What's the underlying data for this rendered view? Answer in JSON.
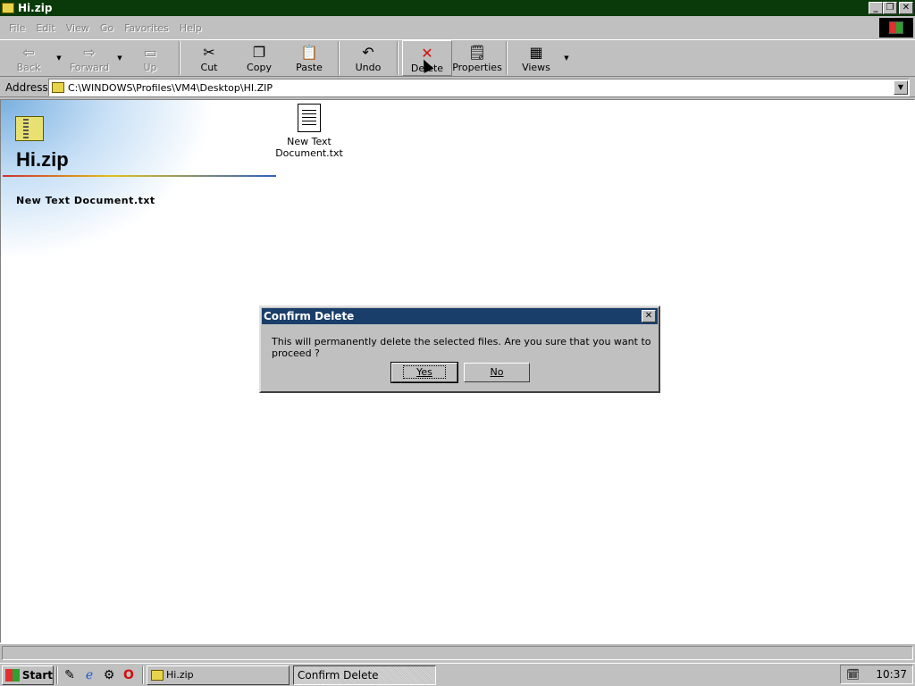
{
  "window": {
    "title": "Hi.zip"
  },
  "menu": [
    "File",
    "Edit",
    "View",
    "Go",
    "Favorites",
    "Help"
  ],
  "toolbar": {
    "back": "Back",
    "forward": "Forward",
    "up": "Up",
    "cut": "Cut",
    "copy": "Copy",
    "paste": "Paste",
    "undo": "Undo",
    "delete": "Delete",
    "properties": "Properties",
    "views": "Views"
  },
  "address": {
    "label": "Address",
    "value": "C:\\WINDOWS\\Profiles\\VM4\\Desktop\\HI.ZIP"
  },
  "webview": {
    "folder_title": "Hi.zip",
    "selected_file": "New Text Document.txt"
  },
  "files": [
    {
      "name_line1": "New Text",
      "name_line2": "Document.txt"
    }
  ],
  "dialog": {
    "title": "Confirm Delete",
    "message": "This will permanently delete the selected files.  Are you sure that you want to proceed ?",
    "yes": "Yes",
    "no": "No"
  },
  "taskbar": {
    "start": "Start",
    "tasks": [
      "Hi.zip",
      "Confirm Delete"
    ],
    "clock": "10:37"
  }
}
